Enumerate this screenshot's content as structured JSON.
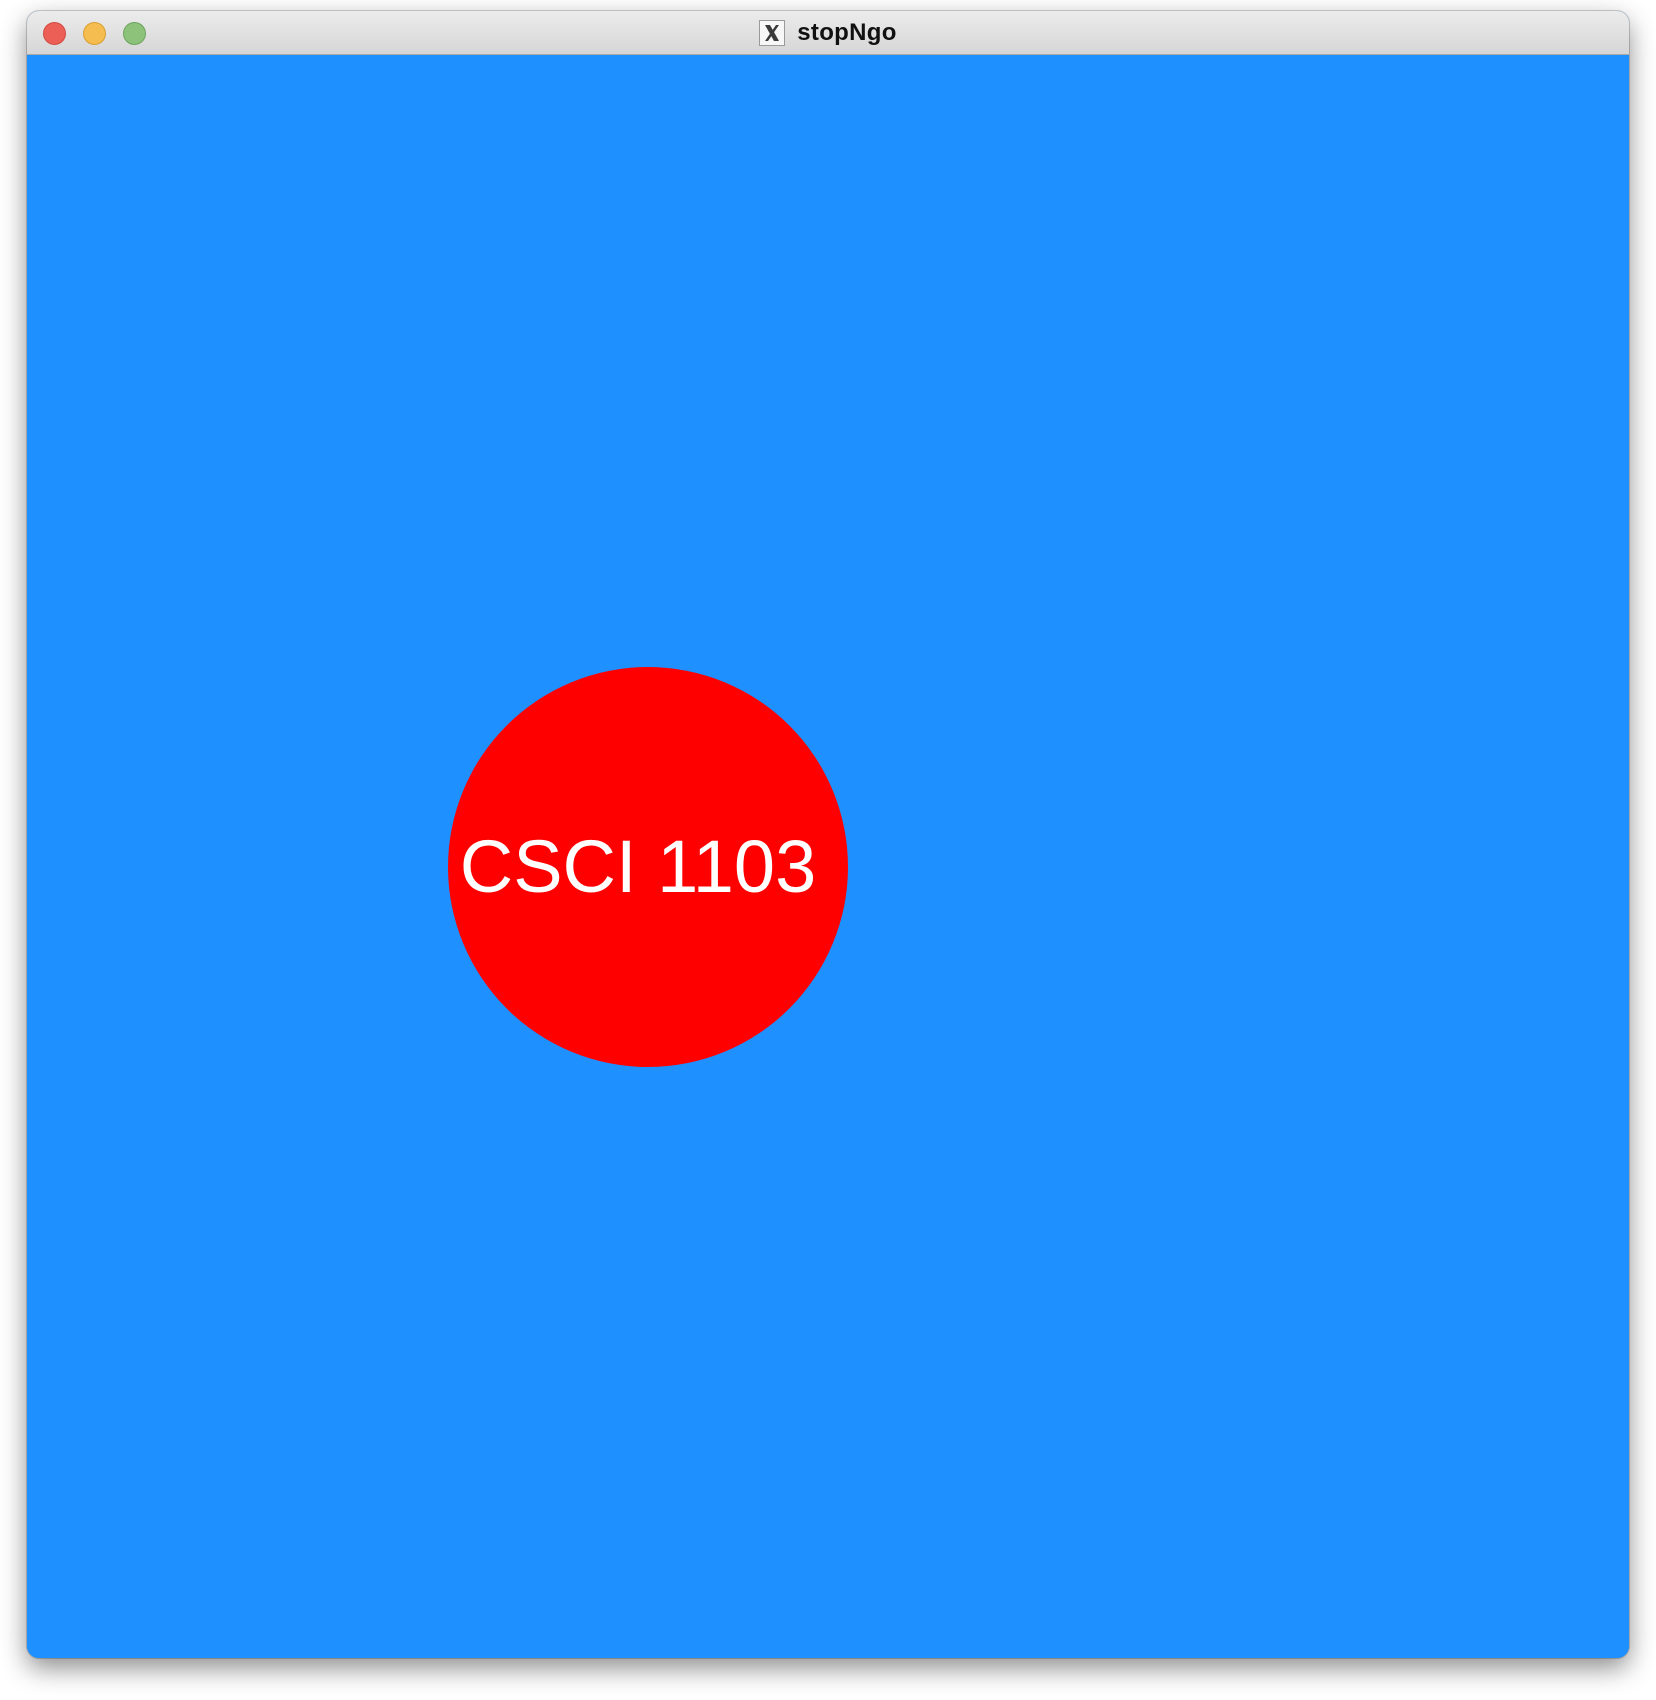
{
  "window": {
    "title": "stopNgo",
    "app_icon": "x11-icon",
    "background_color": "#1e90ff"
  },
  "controls": {
    "close": "close-icon",
    "minimize": "minimize-icon",
    "zoom": "zoom-icon"
  },
  "canvas": {
    "shape": {
      "type": "circle",
      "color": "#ff0000",
      "label": "CSCI 1103",
      "label_color": "#ffffff"
    }
  }
}
